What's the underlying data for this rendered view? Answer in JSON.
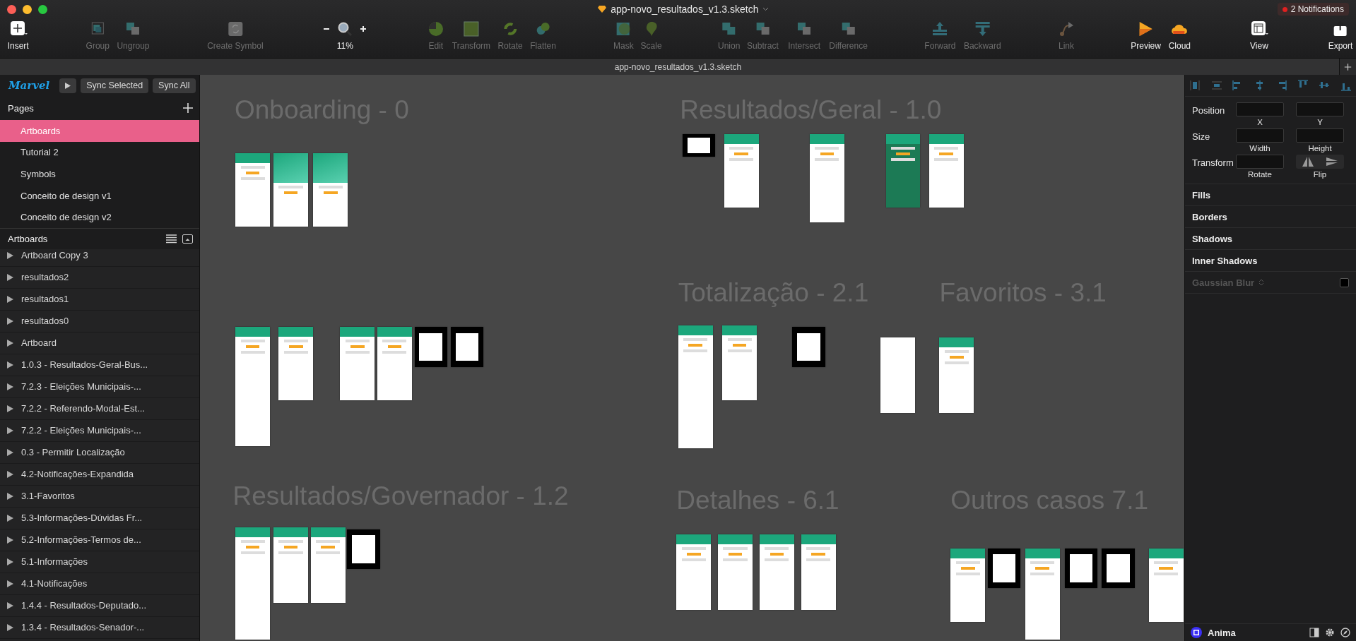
{
  "window": {
    "title": "app-novo_resultados_v1.3.sketch",
    "notifications": "2 Notifications"
  },
  "toolbar": [
    {
      "label": "Insert",
      "enabled": true
    },
    {
      "label": "Group",
      "enabled": false
    },
    {
      "label": "Ungroup",
      "enabled": false
    },
    {
      "label": "Create Symbol",
      "enabled": false
    },
    {
      "label": "11%",
      "enabled": true,
      "kind": "zoom"
    },
    {
      "label": "Edit",
      "enabled": false
    },
    {
      "label": "Transform",
      "enabled": false
    },
    {
      "label": "Rotate",
      "enabled": false
    },
    {
      "label": "Flatten",
      "enabled": false
    },
    {
      "label": "Mask",
      "enabled": false
    },
    {
      "label": "Scale",
      "enabled": false
    },
    {
      "label": "Union",
      "enabled": false
    },
    {
      "label": "Subtract",
      "enabled": false
    },
    {
      "label": "Intersect",
      "enabled": false
    },
    {
      "label": "Difference",
      "enabled": false
    },
    {
      "label": "Forward",
      "enabled": false
    },
    {
      "label": "Backward",
      "enabled": false
    },
    {
      "label": "Link",
      "enabled": false
    },
    {
      "label": "Preview",
      "enabled": true
    },
    {
      "label": "Cloud",
      "enabled": true
    },
    {
      "label": "View",
      "enabled": true
    },
    {
      "label": "Export",
      "enabled": true
    }
  ],
  "tab_bar": {
    "title": "app-novo_resultados_v1.3.sketch"
  },
  "sidebar": {
    "plugin": {
      "logo": "Marvel",
      "buttons": [
        "Sync Selected",
        "Sync All"
      ]
    },
    "pages_title": "Pages",
    "pages": [
      {
        "label": "Artboards",
        "selected": true
      },
      {
        "label": "Tutorial 2",
        "selected": false
      },
      {
        "label": "Symbols",
        "selected": false
      },
      {
        "label": "Conceito de design v1",
        "selected": false
      },
      {
        "label": "Conceito de design v2",
        "selected": false
      }
    ],
    "artboards_title": "Artboards",
    "artboards": [
      {
        "label": "Artboard Copy 3",
        "expanded": false
      },
      {
        "label": "resultados2",
        "expanded": false
      },
      {
        "label": "resultados1",
        "expanded": false
      },
      {
        "label": "resultados0",
        "expanded": false
      },
      {
        "label": "Artboard",
        "expanded": false
      },
      {
        "label": "1.0.3 - Resultados-Geral-Bus...",
        "expanded": false
      },
      {
        "label": "7.2.3 - Eleições Municipais-...",
        "expanded": false
      },
      {
        "label": "7.2.2 - Referendo-Modal-Est...",
        "expanded": false
      },
      {
        "label": "7.2.2 - Eleições Municipais-...",
        "expanded": false
      },
      {
        "label": "0.3 - Permitir Localização",
        "expanded": false
      },
      {
        "label": "4.2-Notificações-Expandida",
        "expanded": false
      },
      {
        "label": "3.1-Favoritos",
        "expanded": false
      },
      {
        "label": "5.3-Informações-Dúvidas Fr...",
        "expanded": false
      },
      {
        "label": "5.2-Informações-Termos de...",
        "expanded": false
      },
      {
        "label": "5.1-Informações",
        "expanded": false
      },
      {
        "label": "4.1-Notificações",
        "expanded": false
      },
      {
        "label": "1.4.4 - Resultados-Deputado...",
        "expanded": false
      },
      {
        "label": "1.3.4 - Resultados-Senador-...",
        "expanded": false
      }
    ]
  },
  "canvas": {
    "sections": [
      "Onboarding - 0",
      "Resultados/Geral - 1.0",
      "Totalização - 2.1",
      "Favoritos - 3.1",
      "Resultados/Governador - 1.2",
      "Detalhes - 6.1",
      "Outros casos 7.1"
    ]
  },
  "inspector": {
    "rows": [
      {
        "label": "Position",
        "fields": [
          "X",
          "Y"
        ]
      },
      {
        "label": "Size",
        "fields": [
          "Width",
          "Height"
        ]
      },
      {
        "label": "Transform",
        "fields": [
          "Rotate"
        ],
        "flip": "Flip"
      }
    ],
    "sections": [
      {
        "label": "Fills",
        "enabled": true
      },
      {
        "label": "Borders",
        "enabled": true
      },
      {
        "label": "Shadows",
        "enabled": true
      },
      {
        "label": "Inner Shadows",
        "enabled": true
      },
      {
        "label": "Gaussian Blur",
        "enabled": false,
        "checked": false
      }
    ],
    "footer": "Anima"
  }
}
